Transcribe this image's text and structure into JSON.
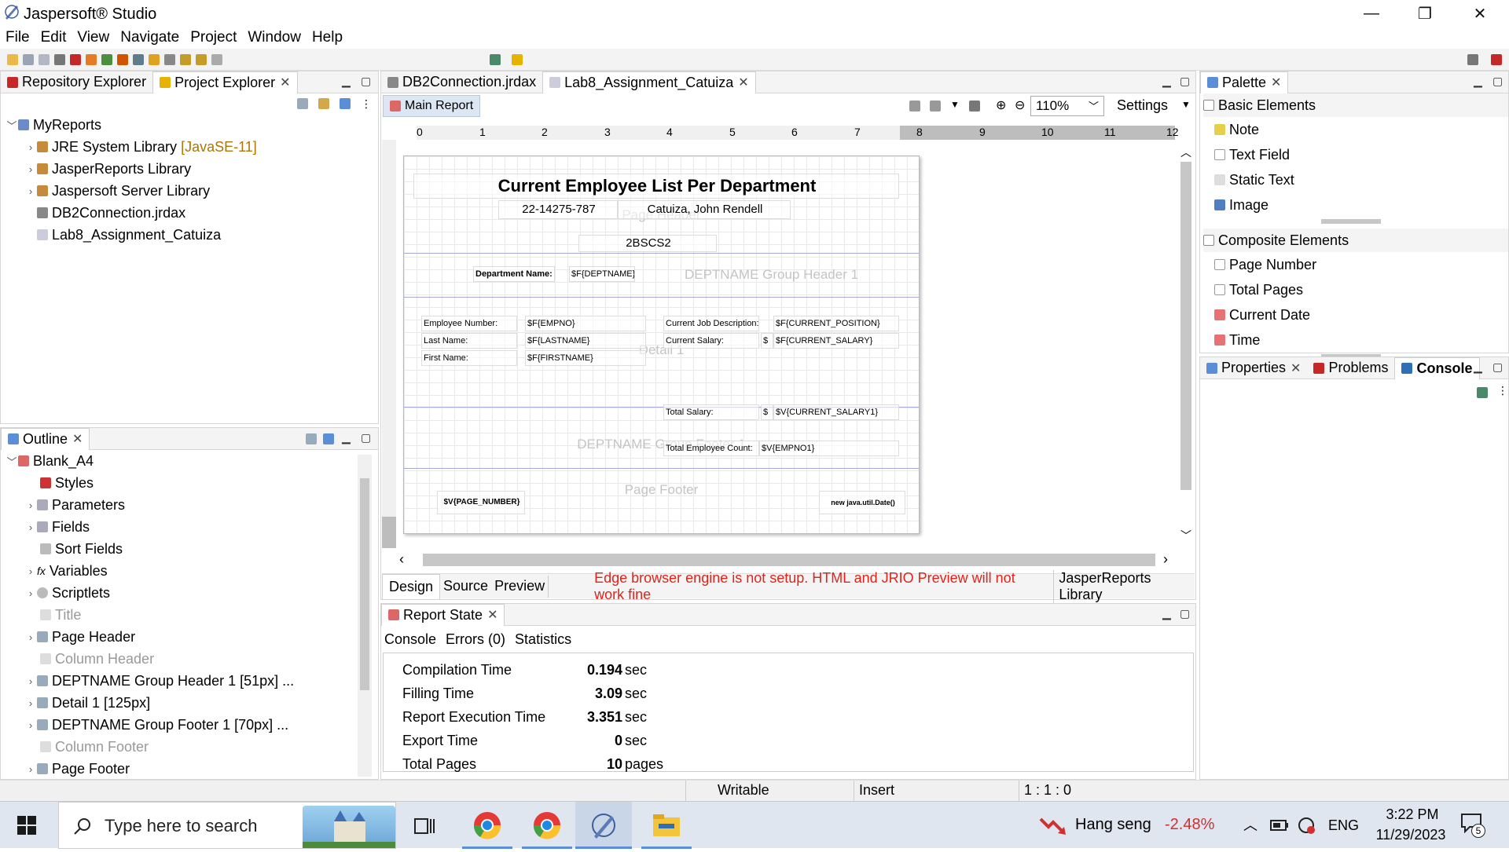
{
  "app": {
    "title": "Jaspersoft® Studio"
  },
  "menu": [
    "File",
    "Edit",
    "View",
    "Navigate",
    "Project",
    "Window",
    "Help"
  ],
  "left_top": {
    "tabs": [
      {
        "label": "Repository Explorer"
      },
      {
        "label": "Project Explorer"
      }
    ],
    "tree": [
      {
        "label": "MyReports",
        "level": 0
      },
      {
        "label": "JRE System Library",
        "suffix": "[JavaSE-11]",
        "level": 1
      },
      {
        "label": "JasperReports Library",
        "level": 1
      },
      {
        "label": "Jaspersoft Server Library",
        "level": 1
      },
      {
        "label": "DB2Connection.jrdax",
        "level": 1
      },
      {
        "label": "Lab8_Assignment_Catuiza",
        "level": 1
      }
    ]
  },
  "outline": {
    "tab": "Outline",
    "root": "Blank_A4",
    "items": [
      "Styles",
      "Parameters",
      "Fields",
      "Sort Fields",
      "Variables",
      "Scriptlets",
      "Title",
      "Page Header",
      "Column Header",
      "DEPTNAME Group Header 1 [51px] ...",
      "Detail 1 [125px]",
      "DEPTNAME Group Footer 1 [70px] ...",
      "Column Footer",
      "Page Footer"
    ]
  },
  "editor": {
    "tabs": [
      {
        "label": "DB2Connection.jrdax"
      },
      {
        "label": "Lab8_Assignment_Catuiza"
      }
    ],
    "subtab": "Main Report",
    "zoom": "110%",
    "settings": "Settings",
    "ruler": [
      "0",
      "1",
      "2",
      "3",
      "4",
      "5",
      "6",
      "7",
      "8",
      "9",
      "10",
      "11",
      "12"
    ],
    "bottom_tabs": [
      "Design",
      "Source",
      "Preview"
    ],
    "warning": "Edge browser engine is not setup. HTML and JRIO Preview will not work fine",
    "lib": "JasperReports Library"
  },
  "report": {
    "title": "Current Employee List Per Department",
    "id": "22-14275-787",
    "name": "Catuiza, John Rendell",
    "section": "2BSCS2",
    "bands": {
      "page_header": "Page Header",
      "group_header": "DEPTNAME Group Header 1",
      "detail": "Detail 1",
      "group_footer": "DEPTNAME Group Footer 1",
      "page_footer": "Page Footer"
    },
    "dept_label": "Department Name:",
    "dept_field": "$F{DEPTNAME}",
    "fields": {
      "emp_no_label": "Employee Number:",
      "emp_no": "$F{EMPNO}",
      "last_label": "Last Name:",
      "last": "$F{LASTNAME}",
      "first_label": "First Name:",
      "first": "$F{FIRSTNAME}",
      "job_label": "Current Job Description:",
      "job": "$F{CURRENT_POSITION}",
      "salary_label": "Current Salary:",
      "salary_sign": "$",
      "salary": "$F{CURRENT_SALARY}"
    },
    "total_salary_label": "Total Salary:",
    "total_salary_sign": "$",
    "total_salary": "$V{CURRENT_SALARY1}",
    "total_count_label": "Total Employee Count:",
    "total_count": "$V{EMPNO1}",
    "page_number": "$V{PAGE_NUMBER}",
    "date": "new java.util.Date()"
  },
  "palette": {
    "tab": "Palette",
    "basic_title": "Basic Elements",
    "basic": [
      "Note",
      "Text Field",
      "Static Text",
      "Image"
    ],
    "composite_title": "Composite Elements",
    "composite": [
      "Page Number",
      "Total Pages",
      "Current Date",
      "Time"
    ]
  },
  "props": {
    "tabs": [
      "Properties",
      "Problems",
      "Console"
    ]
  },
  "report_state": {
    "tab": "Report State",
    "subtabs": [
      "Console",
      "Errors (0)",
      "Statistics"
    ],
    "rows": [
      {
        "label": "Compilation Time",
        "value": "0.194",
        "unit": "sec"
      },
      {
        "label": "Filling Time",
        "value": "3.09",
        "unit": "sec"
      },
      {
        "label": "Report Execution Time",
        "value": "3.351",
        "unit": "sec"
      },
      {
        "label": "Export Time",
        "value": "0",
        "unit": "sec"
      },
      {
        "label": "Total Pages",
        "value": "10",
        "unit": "pages"
      }
    ]
  },
  "status": {
    "writable": "Writable",
    "insert": "Insert",
    "position": "1 : 1 : 0"
  },
  "taskbar": {
    "search": "Type here to search",
    "stock_name": "Hang seng",
    "stock_change": "-2.48%",
    "lang": "ENG",
    "time": "3:22 PM",
    "date": "11/29/2023",
    "notif": "5"
  }
}
